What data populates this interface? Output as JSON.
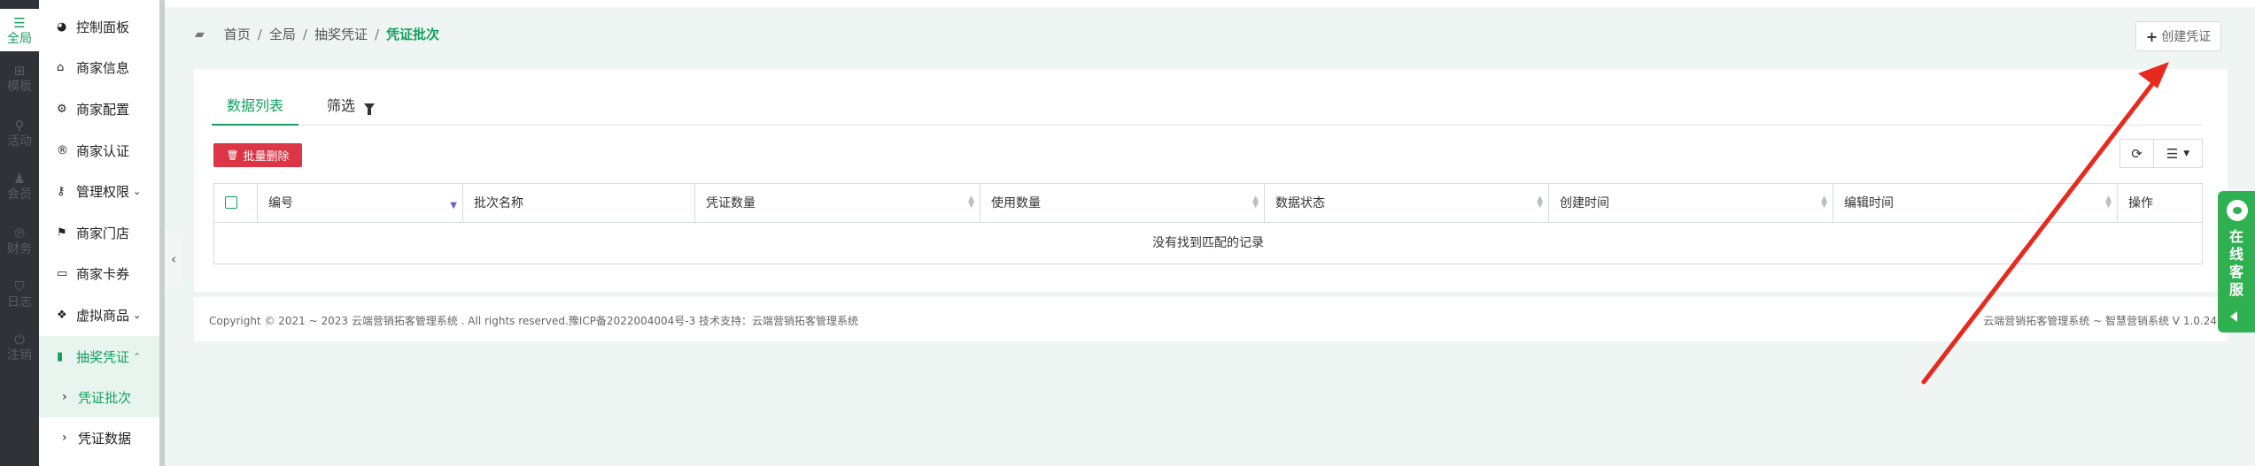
{
  "rail": {
    "items": [
      {
        "label": "全局",
        "icon": "sliders-icon"
      },
      {
        "label": "模板",
        "icon": "sitemap-icon"
      },
      {
        "label": "活动",
        "icon": "pin-icon"
      },
      {
        "label": "会员",
        "icon": "users-icon"
      },
      {
        "label": "财务",
        "icon": "paypal-icon"
      },
      {
        "label": "日志",
        "icon": "shield-icon"
      },
      {
        "label": "注销",
        "icon": "power-icon"
      }
    ]
  },
  "menu": {
    "items": [
      {
        "label": "控制面板",
        "icon": "dashboard-icon"
      },
      {
        "label": "商家信息",
        "icon": "home-icon"
      },
      {
        "label": "商家配置",
        "icon": "cogs-icon"
      },
      {
        "label": "商家认证",
        "icon": "registered-icon"
      },
      {
        "label": "管理权限",
        "icon": "key-icon"
      },
      {
        "label": "商家门店",
        "icon": "map-marker-icon"
      },
      {
        "label": "商家卡券",
        "icon": "credit-card-icon"
      },
      {
        "label": "虚拟商品",
        "icon": "dropbox-icon"
      },
      {
        "label": "抽奖凭证",
        "icon": "bookmark-icon"
      }
    ],
    "sub_items": [
      {
        "label": "凭证批次"
      },
      {
        "label": "凭证数据"
      }
    ]
  },
  "breadcrumb": {
    "items": [
      "首页",
      "全局",
      "抽奖凭证"
    ],
    "current": "凭证批次"
  },
  "header": {
    "create_label": "创建凭证"
  },
  "tabs": {
    "list_label": "数据列表",
    "filter_label": "筛选"
  },
  "toolbar": {
    "batch_delete_label": "批量删除"
  },
  "table": {
    "columns": [
      "编号",
      "批次名称",
      "凭证数量",
      "使用数量",
      "数据状态",
      "创建时间",
      "编辑时间",
      "操作"
    ],
    "empty_text": "没有找到匹配的记录"
  },
  "footer": {
    "left": "Copyright © 2021 ~ 2023 云端营销拓客管理系统 . All rights reserved.豫ICP备2022004004号-3 技术支持：云端营销拓客管理系统",
    "right": "云端营销拓客管理系统 ~ 智慧营销系统 V 1.0.24"
  },
  "chat_widget": {
    "label": "在线客服"
  },
  "colors": {
    "accent": "#13a05f",
    "danger": "#dc3545",
    "rail": "#2f3237",
    "annotation_arrow": "#e8291d"
  }
}
